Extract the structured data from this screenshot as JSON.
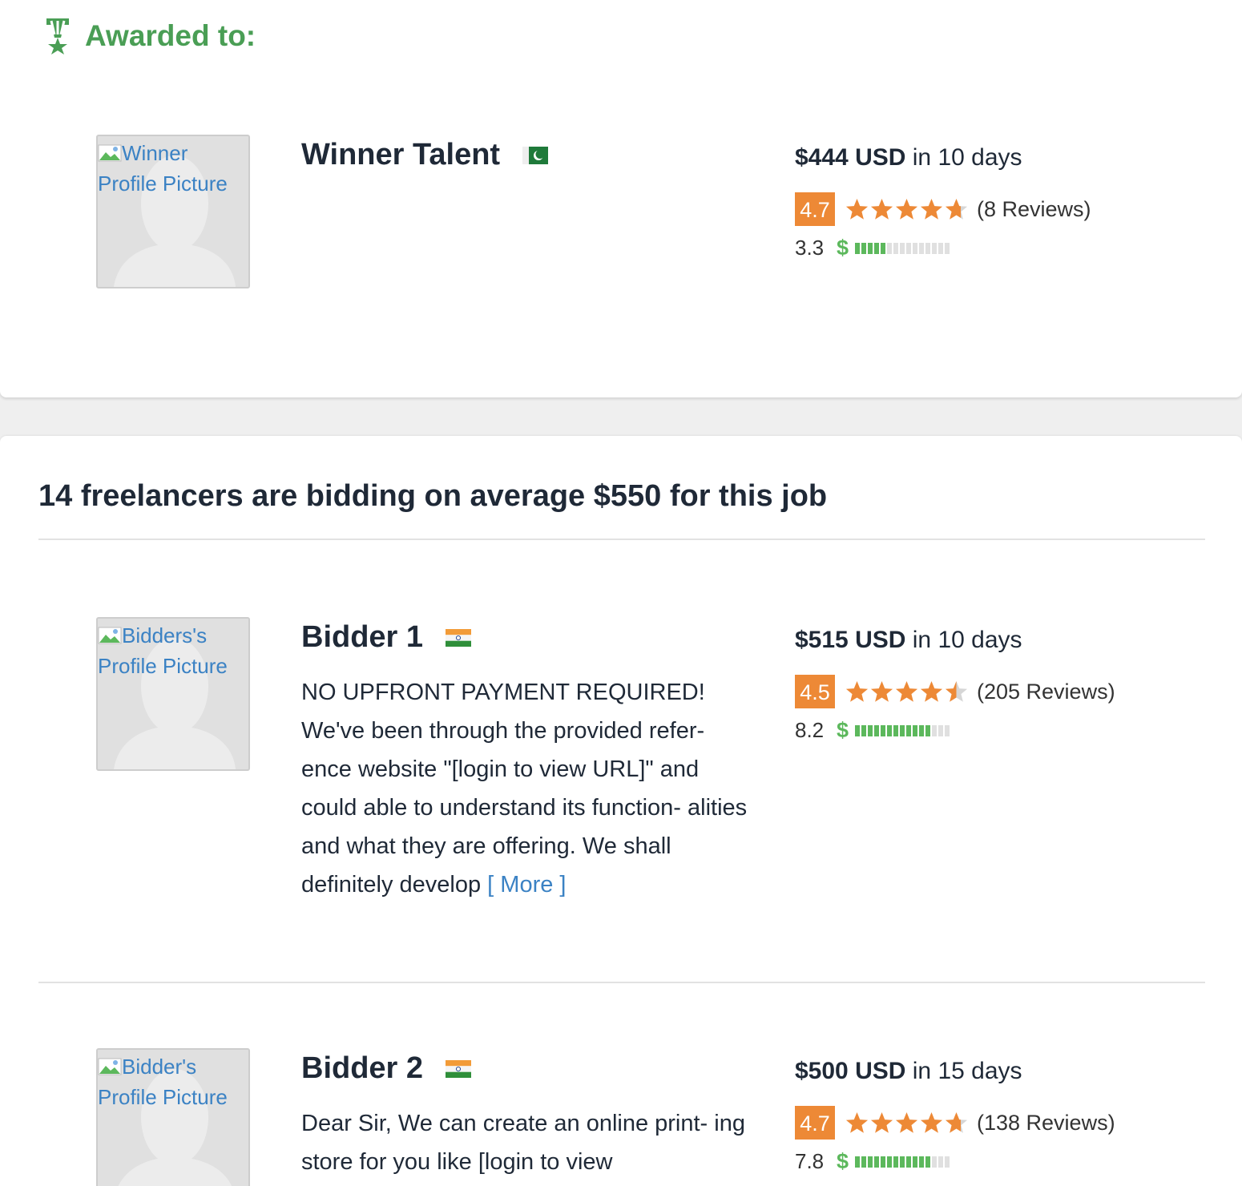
{
  "award": {
    "title": "Awarded to:",
    "winner": {
      "avatar_alt_line1": "Winner",
      "avatar_alt_line2": "Profile Picture",
      "name": "Winner Talent",
      "flag": "pakistan-flag",
      "price_amount": "$444 USD",
      "price_suffix": "in 10 days",
      "rating": "4.7",
      "stars_fill": 0.94,
      "reviews": "(8 Reviews)",
      "earnings_score": "3.3",
      "earnings_level": 0.33
    }
  },
  "bids": {
    "heading": "14 freelancers are bidding on average $550 for this job",
    "bidders": [
      {
        "avatar_alt_line1": "Bidders's",
        "avatar_alt_line2": "Profile Picture",
        "name": "Bidder 1",
        "flag": "india-flag",
        "description": "NO UPFRONT PAYMENT REQUIRED! We've been through the provided refer- ence website \"[login to view URL]\" and could able to understand its function- alities and what they are offering. We shall definitely develop",
        "more_label": "[ More ]",
        "price_amount": "$515 USD",
        "price_suffix": "in 10 days",
        "rating": "4.5",
        "stars_fill": 0.9,
        "reviews": "(205 Reviews)",
        "earnings_score": "8.2",
        "earnings_level": 0.82
      },
      {
        "avatar_alt_line1": "Bidder's",
        "avatar_alt_line2": "Profile Picture",
        "name": "Bidder 2",
        "flag": "india-flag",
        "description": "Dear Sir, We can create an online print- ing store for you like [login to view",
        "price_amount": "$500 USD",
        "price_suffix": "in 15 days",
        "rating": "4.7",
        "stars_fill": 0.94,
        "reviews": "(138 Reviews)",
        "earnings_score": "7.8",
        "earnings_level": 0.78
      }
    ]
  },
  "colors": {
    "accent_green": "#4a9e55",
    "rating_orange": "#ed8936",
    "link_blue": "#3b82c4",
    "earnings_green": "#5cb85c"
  }
}
